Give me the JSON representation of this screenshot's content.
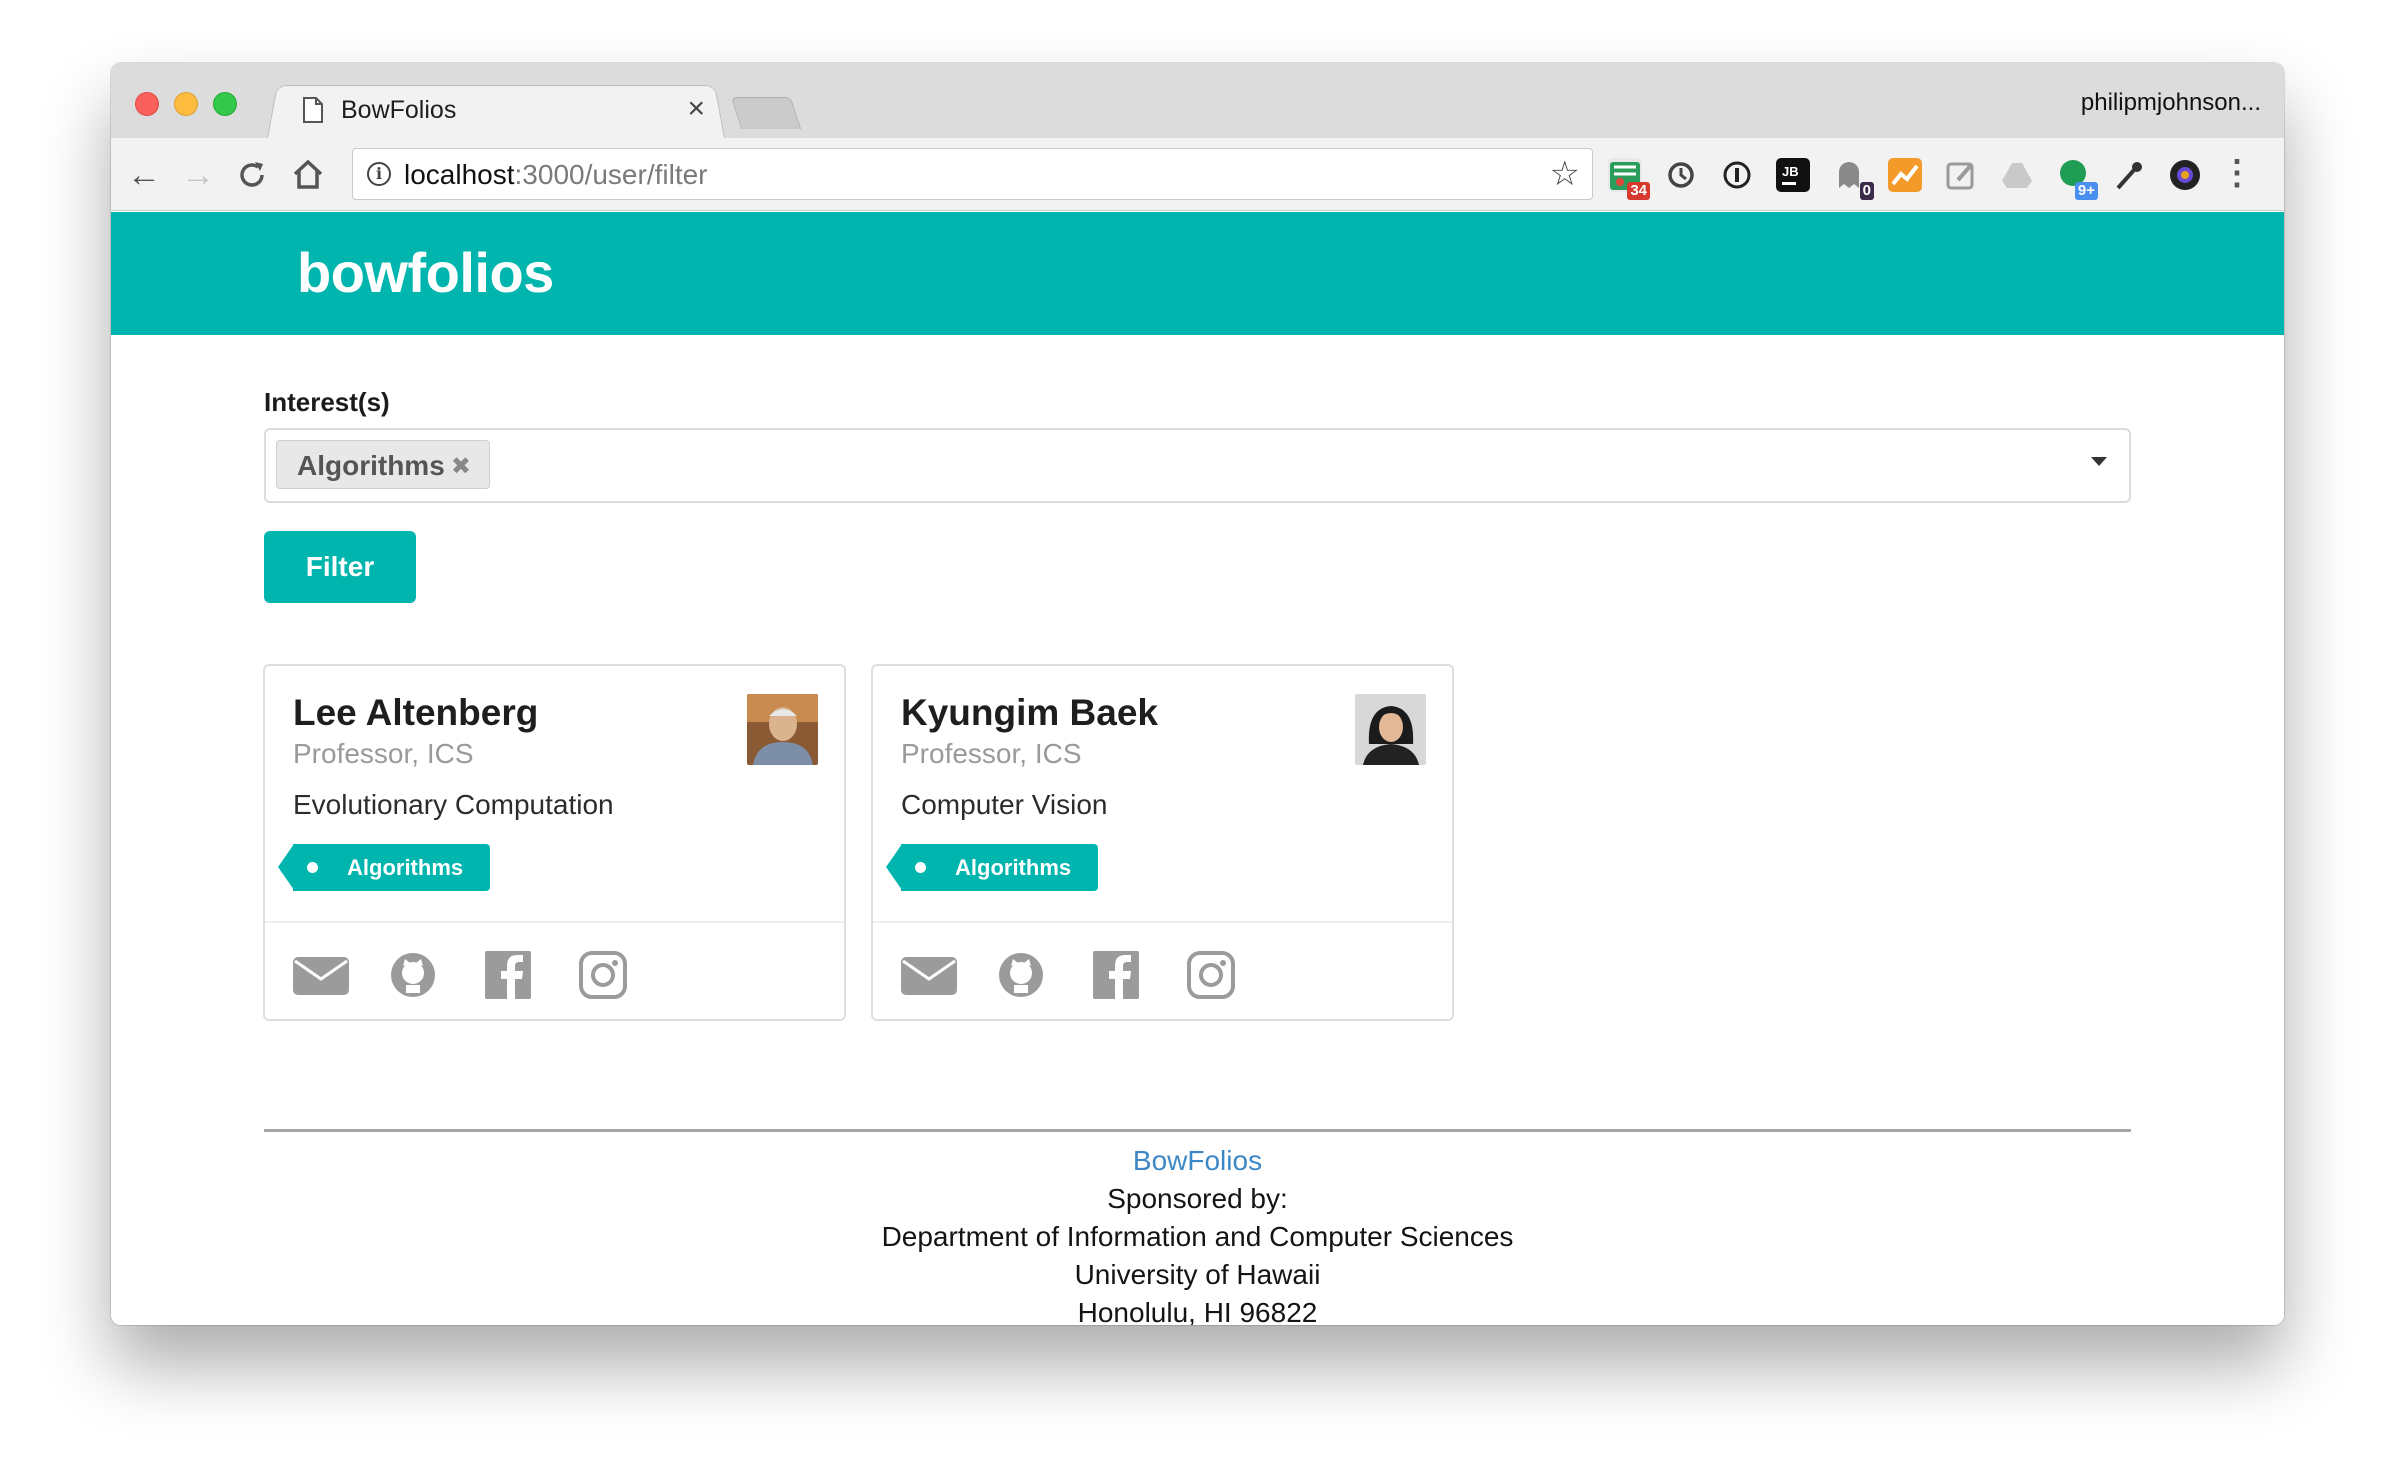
{
  "browser": {
    "tab_title": "BowFolios",
    "tab_close": "×",
    "profile_name": "philipmjohnson...",
    "url_host": "localhost",
    "url_path": ":3000/user/filter",
    "extension_badges": {
      "calendar": "34",
      "ghost": "0",
      "drive_circle": "9+"
    }
  },
  "page": {
    "brand": "bowfolios",
    "filter_form": {
      "label": "Interest(s)",
      "selected_chips": [
        "Algorithms"
      ],
      "chip_remove_glyph": "✖",
      "submit_label": "Filter"
    },
    "profiles": [
      {
        "name": "Lee Altenberg",
        "title": "Professor, ICS",
        "description": "Evolutionary Computation",
        "tags": [
          "Algorithms"
        ]
      },
      {
        "name": "Kyungim Baek",
        "title": "Professor, ICS",
        "description": "Computer Vision",
        "tags": [
          "Algorithms"
        ]
      }
    ],
    "social_icons": [
      "envelope-icon",
      "github-icon",
      "facebook-icon",
      "instagram-icon"
    ],
    "footer": {
      "link": "BowFolios",
      "lines": [
        "Sponsored by:",
        "Department of Information and Computer Sciences",
        "University of Hawaii",
        "Honolulu, HI 96822"
      ]
    }
  },
  "colors": {
    "brand_teal": "#00b5ad",
    "link_blue": "#3c87c6",
    "muted_text": "#9a9a9a"
  }
}
